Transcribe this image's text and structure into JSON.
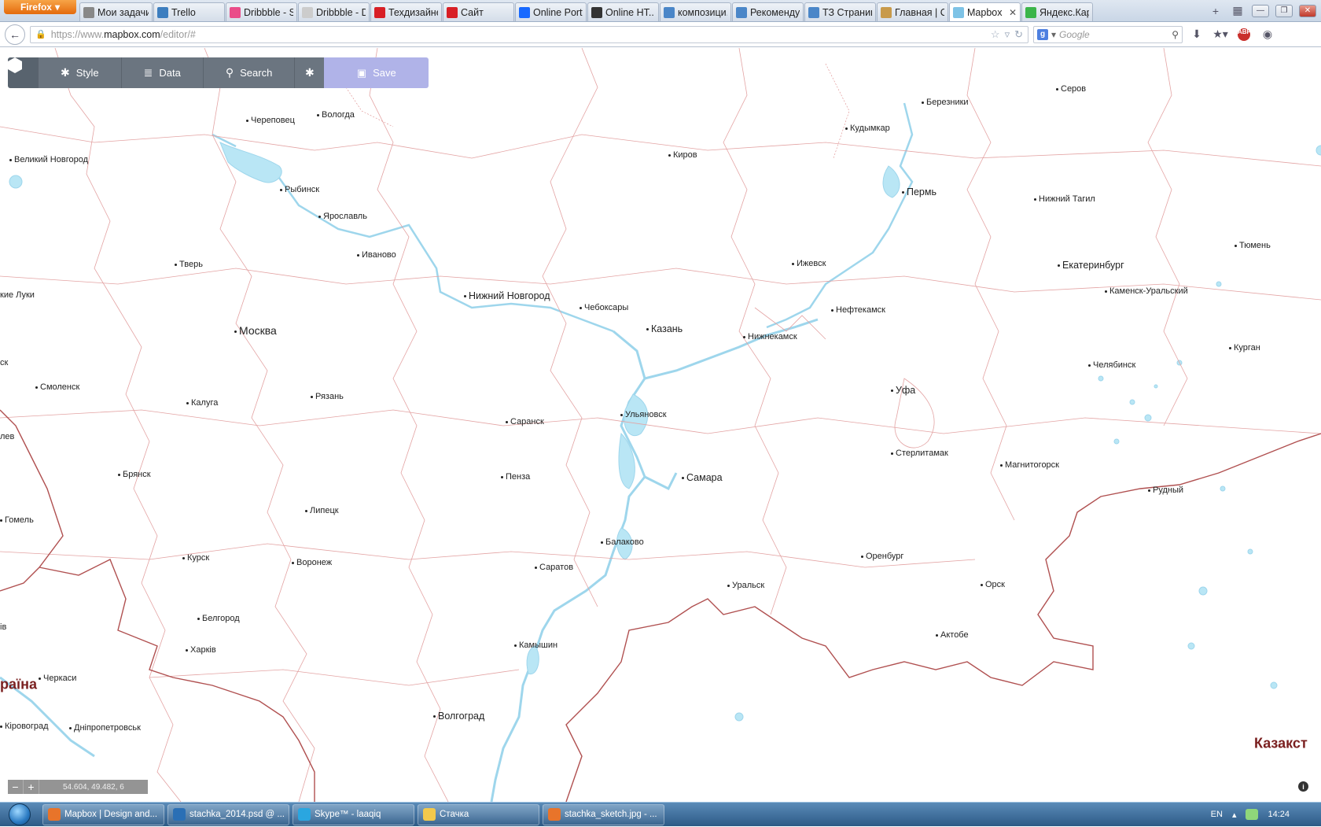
{
  "browser": {
    "menu_label": "Firefox",
    "tabs": [
      {
        "label": "Мои задачи",
        "color": "#888888",
        "active": false
      },
      {
        "label": "Trello",
        "color": "#3d7ebf",
        "active": false
      },
      {
        "label": "Dribbble - S...",
        "color": "#ea4c89",
        "active": false
      },
      {
        "label": "Dribbble - D...",
        "color": "#cccccc",
        "active": false
      },
      {
        "label": "Техдизайне...",
        "color": "#d81f26",
        "active": false
      },
      {
        "label": "Сайт",
        "color": "#d81f26",
        "active": false
      },
      {
        "label": "Online Portf...",
        "color": "#1769ff",
        "active": false
      },
      {
        "label": "Online HT...",
        "color": "#333333",
        "active": false
      },
      {
        "label": "композици...",
        "color": "#4a86c8",
        "active": false
      },
      {
        "label": "Рекоменду...",
        "color": "#4a86c8",
        "active": false
      },
      {
        "label": "ТЗ Страниц...",
        "color": "#4a86c8",
        "active": false
      },
      {
        "label": "Главная | С...",
        "color": "#c89a4a",
        "active": false
      },
      {
        "label": "Mapbox ...",
        "color": "#7ec3e6",
        "active": true
      },
      {
        "label": "Яндекс.Кар...",
        "color": "#3bb54a",
        "active": false
      }
    ],
    "url_prefix": "https://www.",
    "url_domain": "mapbox.com",
    "url_path": "/editor/#",
    "search_placeholder": "Google"
  },
  "toolbar": {
    "style_label": "Style",
    "data_label": "Data",
    "search_label": "Search",
    "save_label": "Save"
  },
  "map": {
    "water_color": "#b9e6f5",
    "border_color": "#e3a3a3",
    "country_border_color": "#b05050",
    "cities": [
      {
        "name": "Серов",
        "cls": ""
      },
      {
        "name": "Березники",
        "cls": ""
      },
      {
        "name": "Кудымкар",
        "cls": ""
      },
      {
        "name": "Череповец",
        "cls": ""
      },
      {
        "name": "Вологда",
        "cls": ""
      },
      {
        "name": "Киров",
        "cls": ""
      },
      {
        "name": "Великий Новгород",
        "cls": ""
      },
      {
        "name": "Рыбинск",
        "cls": ""
      },
      {
        "name": "Пермь",
        "cls": "mid"
      },
      {
        "name": "Нижний Тагил",
        "cls": ""
      },
      {
        "name": "Ярославль",
        "cls": ""
      },
      {
        "name": "Тюмень",
        "cls": ""
      },
      {
        "name": "Иваново",
        "cls": ""
      },
      {
        "name": "Тверь",
        "cls": ""
      },
      {
        "name": "Ижевск",
        "cls": ""
      },
      {
        "name": "Екатеринбург",
        "cls": "mid"
      },
      {
        "name": "Нижний Новгород",
        "cls": "mid"
      },
      {
        "name": "Каменск-Уральский",
        "cls": ""
      },
      {
        "name": "кие Луки",
        "cls": "plain"
      },
      {
        "name": "Чебоксары",
        "cls": ""
      },
      {
        "name": "Нефтекамск",
        "cls": ""
      },
      {
        "name": "Москва",
        "cls": "big"
      },
      {
        "name": "Казань",
        "cls": "mid"
      },
      {
        "name": "Нижнекамск",
        "cls": ""
      },
      {
        "name": "Курган",
        "cls": ""
      },
      {
        "name": "Челябинск",
        "cls": ""
      },
      {
        "name": "Смоленск",
        "cls": ""
      },
      {
        "name": "Уфа",
        "cls": "mid"
      },
      {
        "name": "Рязань",
        "cls": ""
      },
      {
        "name": "Калуга",
        "cls": ""
      },
      {
        "name": "Ульяновск",
        "cls": ""
      },
      {
        "name": "Саранск",
        "cls": ""
      },
      {
        "name": "Стерлитамак",
        "cls": ""
      },
      {
        "name": "Магнитогорск",
        "cls": ""
      },
      {
        "name": "Брянск",
        "cls": ""
      },
      {
        "name": "Пенза",
        "cls": ""
      },
      {
        "name": "Самара",
        "cls": "mid"
      },
      {
        "name": "Рудный",
        "cls": ""
      },
      {
        "name": "Липецк",
        "cls": ""
      },
      {
        "name": "Гомель",
        "cls": ""
      },
      {
        "name": "Балаково",
        "cls": ""
      },
      {
        "name": "Оренбург",
        "cls": ""
      },
      {
        "name": "Курск",
        "cls": ""
      },
      {
        "name": "Воронеж",
        "cls": ""
      },
      {
        "name": "Саратов",
        "cls": ""
      },
      {
        "name": "Уральск",
        "cls": ""
      },
      {
        "name": "Орск",
        "cls": ""
      },
      {
        "name": "Белгород",
        "cls": ""
      },
      {
        "name": "Актобе",
        "cls": ""
      },
      {
        "name": "Харків",
        "cls": ""
      },
      {
        "name": "Камышин",
        "cls": ""
      },
      {
        "name": "Черкаси",
        "cls": ""
      },
      {
        "name": "раїна",
        "cls": "country"
      },
      {
        "name": "Волгоград",
        "cls": "mid"
      },
      {
        "name": "Кіровоград",
        "cls": ""
      },
      {
        "name": "Дніпропетровськ",
        "cls": ""
      },
      {
        "name": "Казакст",
        "cls": "country"
      },
      {
        "name": "ск",
        "cls": "plain"
      },
      {
        "name": "лев",
        "cls": "plain"
      },
      {
        "name": "ів",
        "cls": "plain"
      }
    ],
    "zoom_coords": "54.604, 49.482, 6"
  },
  "taskbar": {
    "tasks": [
      {
        "label": "Mapbox | Design and...",
        "color": "#e8742a"
      },
      {
        "label": "stachka_2014.psd @ ...",
        "color": "#2a6fb5"
      },
      {
        "label": "Skype™ - laaqiq",
        "color": "#2aa6e0"
      },
      {
        "label": "Стачка",
        "color": "#f2c94c"
      },
      {
        "label": "stachka_sketch.jpg - ...",
        "color": "#e8742a"
      }
    ],
    "language": "EN",
    "time": "14:24"
  }
}
